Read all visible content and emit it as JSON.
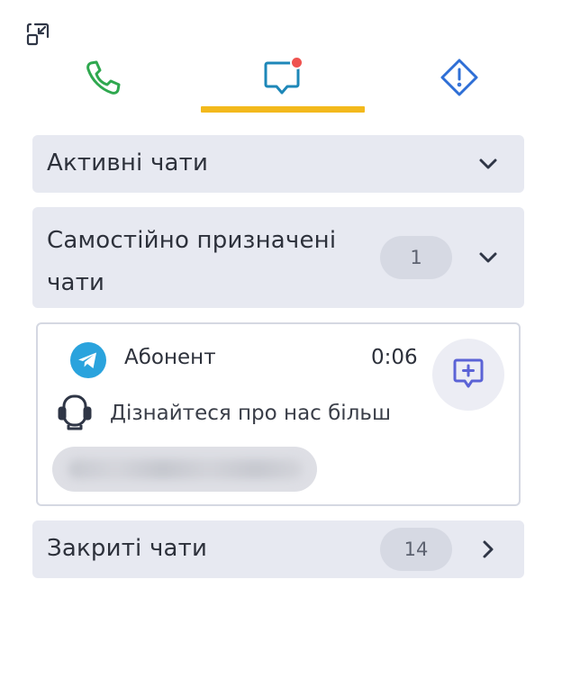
{
  "tabs": [
    {
      "id": "calls",
      "icon": "phone-icon",
      "color": "#2fa84f",
      "active": false
    },
    {
      "id": "chats",
      "icon": "chat-bubble-icon",
      "color": "#1d87b8",
      "active": true,
      "has_notification": true
    },
    {
      "id": "alerts",
      "icon": "warning-diamond-icon",
      "color": "#2f6fd6",
      "active": false
    }
  ],
  "colors": {
    "active_tab_underline": "#f3b91c",
    "notification_dot": "#ef5350",
    "section_bg": "#e7e9f1",
    "reply_icon": "#5b63d6",
    "telegram": "#2aa3dd"
  },
  "sections": {
    "active": {
      "title": "Активні чати",
      "expanded": false
    },
    "assigned": {
      "title": "Самостійно призначені чати",
      "count": "1",
      "expanded": true
    },
    "closed": {
      "title": "Закриті чати",
      "count": "14",
      "expanded": false
    }
  },
  "chat": {
    "channel_icon": "telegram-icon",
    "subscriber": "Абонент",
    "time": "0:06",
    "sender_icon": "bot-icon",
    "preview": "Дізнайтеся про нас більш",
    "reply_icon": "add-message-icon"
  }
}
